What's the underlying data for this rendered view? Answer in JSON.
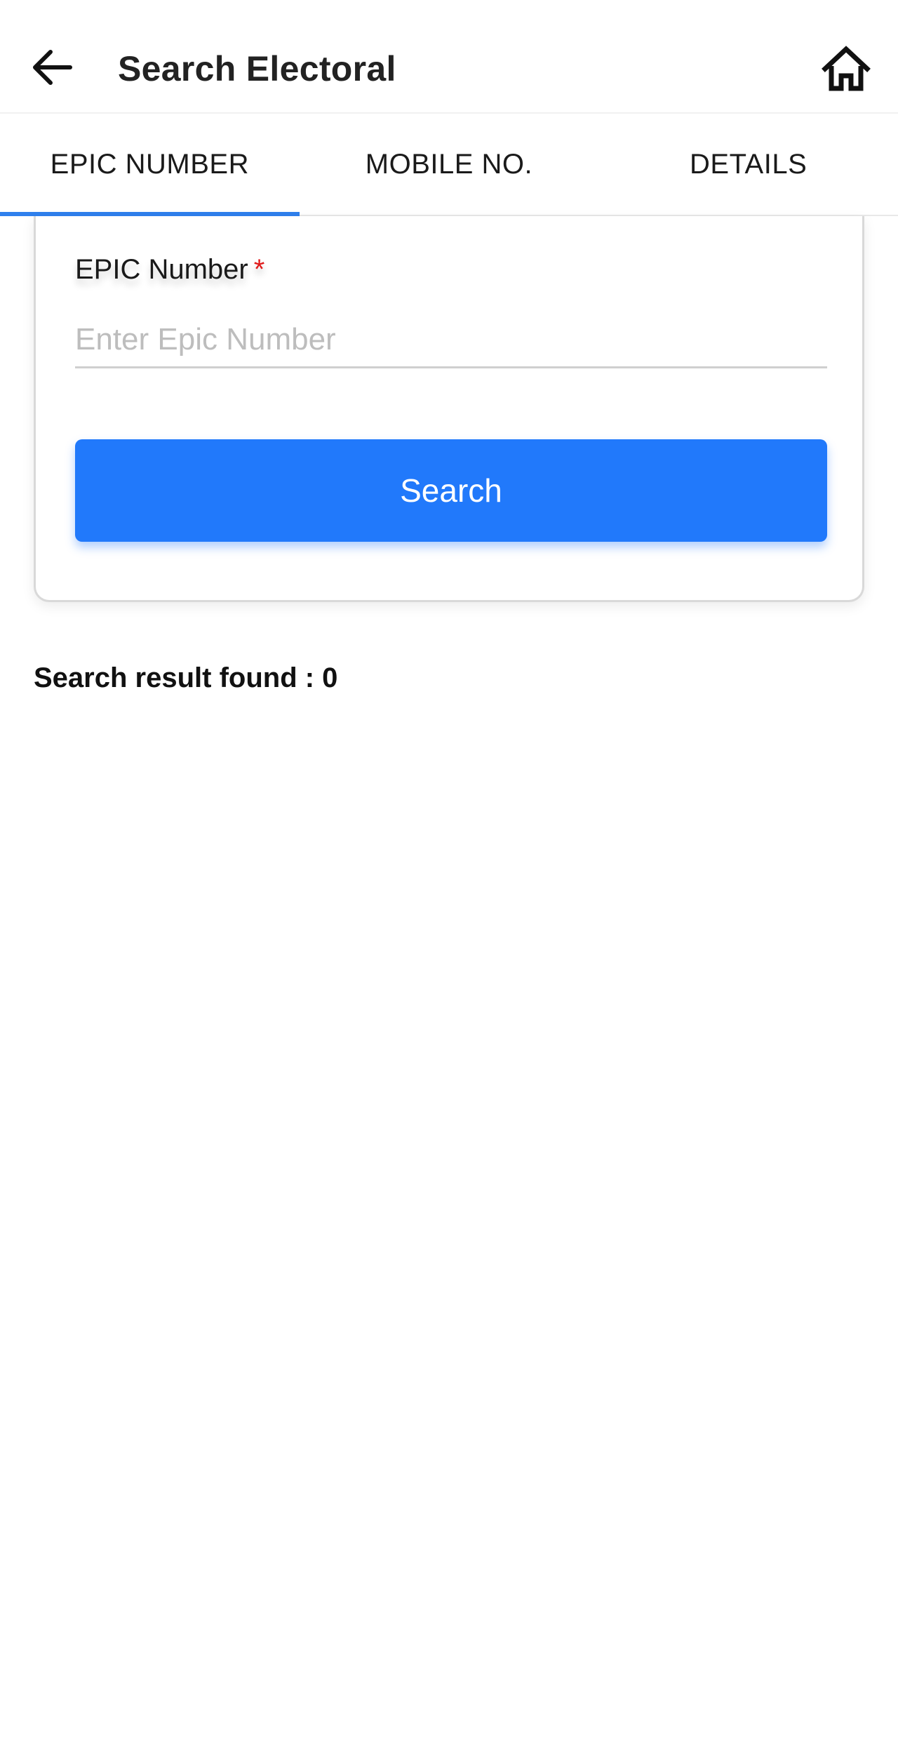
{
  "header": {
    "title": "Search Electoral",
    "back_icon": "arrow-left-icon",
    "home_icon": "home-icon"
  },
  "tabs": [
    {
      "label": "EPIC NUMBER",
      "active": true
    },
    {
      "label": "MOBILE NO.",
      "active": false
    },
    {
      "label": "DETAILS",
      "active": false
    }
  ],
  "form": {
    "field_label": "EPIC Number",
    "required_mark": "*",
    "input_value": "",
    "input_placeholder": "Enter Epic Number",
    "search_button_label": "Search"
  },
  "results": {
    "summary": "Search result found : 0"
  },
  "colors": {
    "accent": "#2179fb",
    "tab_indicator": "#2f80ed",
    "required": "#e01b1b"
  }
}
